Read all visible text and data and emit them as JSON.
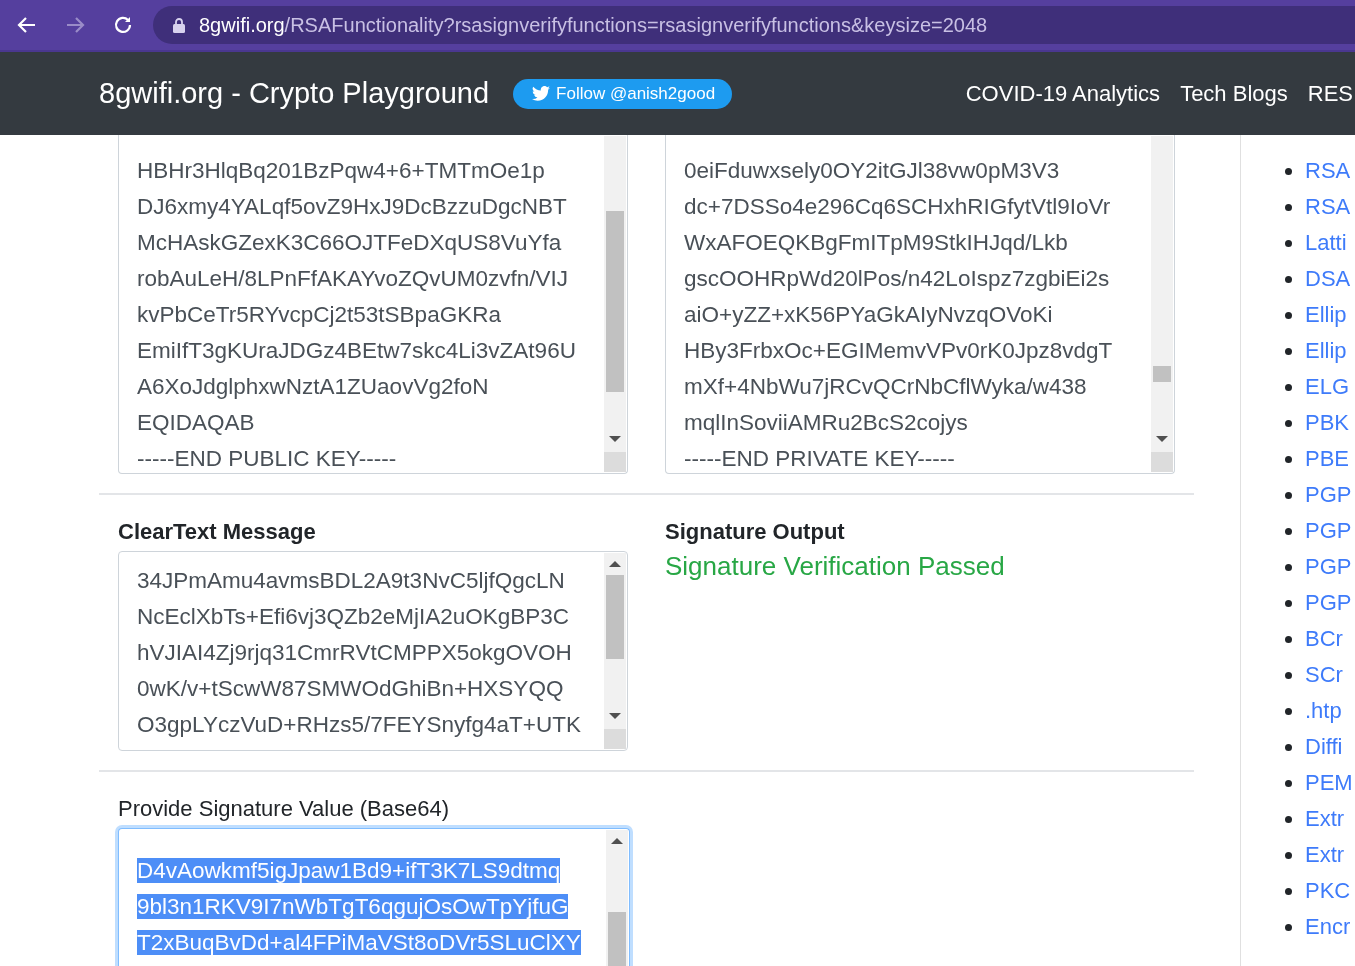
{
  "browser": {
    "back": {
      "disabled": false
    },
    "forward": {
      "disabled": true
    },
    "url": {
      "host": "8gwifi.org",
      "path": "/RSAFunctionality?rsasignverifyfunctions=rsasignverifyfunctions&keysize=2048"
    }
  },
  "navbar": {
    "brand": "8gwifi.org - Crypto Playground",
    "follow_button": "Follow @anish2good",
    "links": [
      "COVID-19 Analytics",
      "Tech Blogs",
      "RES"
    ]
  },
  "keys": [
    {
      "lines": [
        "HBHr3HlqBq201BzPqw4+6+TMTmOe1p",
        "DJ6xmy4YALqf5ovZ9HxJ9DcBzzuDgcNBT",
        "McHAskGZexK3C66OJTFeDXqUS8VuYfa",
        "robAuLeH/8LPnFfAKAYvoZQvUM0zvfn/VIJ",
        "kvPbCeTr5RYvcpCj2t53tSBpaGKRa",
        "EmiIfT3gKUraJDGz4BEtw7skc4Li3vZAt96U",
        "A6XoJdglphxwNztA1ZUaovVg2foN",
        "EQIDAQAB",
        "-----END PUBLIC KEY-----"
      ]
    },
    {
      "lines": [
        "0eiFduwxsely0OY2itGJl38vw0pM3V3",
        "dc+7DSSo4e296Cq6SCHxhRIGfytVtl9IoVr",
        "WxAFOEQKBgFmITpM9StkIHJqd/Lkb",
        "gscOOHRpWd20lPos/n42LoIspz7zgbiEi2s",
        "aiO+yZZ+xK56PYaGkAIyNvzqOVoKi",
        "HBy3FrbxOc+EGIMemvVPv0rK0Jpz8vdgT",
        "mXf+4NbWu7jRCvQCrNbCflWyka/w438",
        "mqlInSoviiAMRu2BcS2cojys",
        "-----END PRIVATE KEY-----"
      ]
    }
  ],
  "cleartext": {
    "label": "ClearText Message",
    "lines": [
      "34JPmAmu4avmsBDL2A9t3NvC5ljfQgcLN",
      "NcEclXbTs+Efi6vj3QZb2eMjIA2uOKgBP3C",
      "hVJIAI4Zj9rjq31CmrRVtCMPPX5okgOVOH",
      "0wK/v+tScwW87SMWOdGhiBn+HXSYQQ",
      "O3gpLYczVuD+RHzs5/7FEYSnyfg4aT+UTK"
    ]
  },
  "signature_output": {
    "label": "Signature Output",
    "status": "Signature Verification Passed",
    "passed": true
  },
  "signature_value": {
    "label": "Provide Signature Value (Base64)",
    "focused": true,
    "selected": true,
    "lines": [
      "D4vAowkmf5igJpaw1Bd9+ifT3K7LS9dtmq",
      "9bl3n1RKV9I7nWbTgT6qgujOsOwTpYjfuG",
      "T2xBuqBvDd+al4FPiMaVSt8oDVr5SLuClXY"
    ]
  },
  "sidebar": {
    "items": [
      "RSA",
      "RSA",
      "Latti",
      "DSA",
      "Ellip",
      "Ellip",
      "ELG",
      "PBK",
      "PBE",
      "PGP",
      "PGP",
      "PGP",
      "PGP",
      "BCr",
      "SCr",
      ".htp",
      "Diffi",
      "PEM",
      "Extr",
      "Extr",
      "PKC",
      "Encr"
    ]
  }
}
